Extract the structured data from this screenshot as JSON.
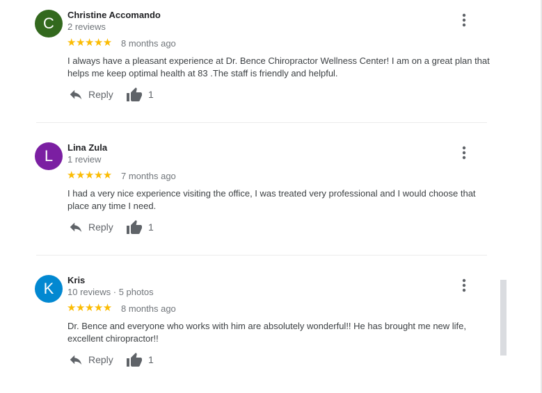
{
  "colors": {
    "star": "#fbbc04",
    "avatar_c": "#33691e",
    "avatar_l": "#7b1fa2",
    "avatar_k": "#0288d1"
  },
  "reviews": [
    {
      "initial": "C",
      "name": "Christine Accomando",
      "meta": "2 reviews",
      "stars": "★★★★★",
      "rating": 5,
      "date": "8 months ago",
      "text": "I always have a pleasant experience at Dr. Bence  Chiropractor Wellness Center! I am on a great plan that helps me keep optimal health at 83 .The staff is friendly and helpful.",
      "reply_label": "Reply",
      "likes": "1"
    },
    {
      "initial": "L",
      "name": "Lina Zula",
      "meta": "1 review",
      "stars": "★★★★★",
      "rating": 5,
      "date": "7 months ago",
      "text": "I had a very nice experience visiting the office,  I was treated very professional and I would choose that place any time I need.",
      "reply_label": "Reply",
      "likes": "1"
    },
    {
      "initial": "K",
      "name": "Kris",
      "meta": "10 reviews · 5 photos",
      "stars": "★★★★★",
      "rating": 5,
      "date": "8 months ago",
      "text": "Dr. Bence and everyone who works with him are absolutely wonderful!! He has brought me new life, excellent chiropractor!!",
      "reply_label": "Reply",
      "likes": "1"
    }
  ]
}
